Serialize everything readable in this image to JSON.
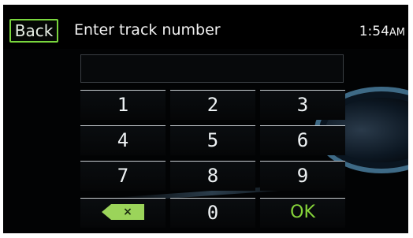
{
  "header": {
    "back_label": "Back",
    "title": "Enter track number",
    "time": "1:54",
    "ampm": "AM"
  },
  "entry": {
    "value": ""
  },
  "keypad": {
    "keys": [
      "1",
      "2",
      "3",
      "4",
      "5",
      "6",
      "7",
      "8",
      "9"
    ],
    "zero": "0",
    "ok_label": "OK",
    "backspace_symbol": "×"
  },
  "colors": {
    "accent": "#79d63d",
    "ok_text": "#86d43a",
    "background": "#020304"
  }
}
